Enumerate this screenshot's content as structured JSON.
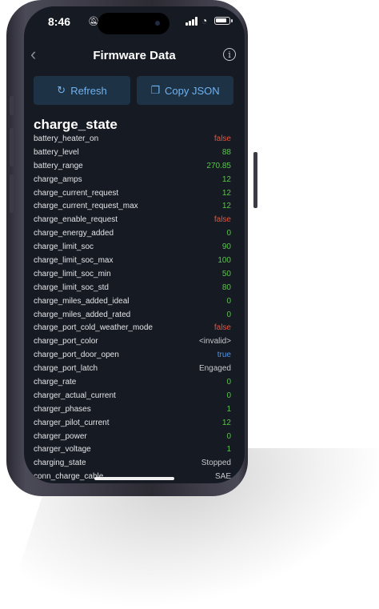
{
  "status_bar": {
    "time": "8:46"
  },
  "nav": {
    "title": "Firmware Data",
    "back_icon": "chevron-left-icon",
    "info_icon": "info-icon"
  },
  "actions": {
    "refresh_label": "Refresh",
    "copy_label": "Copy JSON"
  },
  "section_title": "charge_state",
  "colors": {
    "false": "#e8533f",
    "true": "#4f95e6",
    "number": "#5cc24e",
    "text": "#c6c9cd",
    "button_bg": "#1e3245",
    "button_text": "#6fb2ef"
  },
  "rows": [
    {
      "key": "battery_heater_on",
      "value": "false",
      "type": "bool-false"
    },
    {
      "key": "battery_level",
      "value": "88",
      "type": "num"
    },
    {
      "key": "battery_range",
      "value": "270.85",
      "type": "num"
    },
    {
      "key": "charge_amps",
      "value": "12",
      "type": "num"
    },
    {
      "key": "charge_current_request",
      "value": "12",
      "type": "num"
    },
    {
      "key": "charge_current_request_max",
      "value": "12",
      "type": "num"
    },
    {
      "key": "charge_enable_request",
      "value": "false",
      "type": "bool-false"
    },
    {
      "key": "charge_energy_added",
      "value": "0",
      "type": "num"
    },
    {
      "key": "charge_limit_soc",
      "value": "90",
      "type": "num"
    },
    {
      "key": "charge_limit_soc_max",
      "value": "100",
      "type": "num"
    },
    {
      "key": "charge_limit_soc_min",
      "value": "50",
      "type": "num"
    },
    {
      "key": "charge_limit_soc_std",
      "value": "80",
      "type": "num"
    },
    {
      "key": "charge_miles_added_ideal",
      "value": "0",
      "type": "num"
    },
    {
      "key": "charge_miles_added_rated",
      "value": "0",
      "type": "num"
    },
    {
      "key": "charge_port_cold_weather_mode",
      "value": "false",
      "type": "bool-false"
    },
    {
      "key": "charge_port_color",
      "value": "<invalid>",
      "type": "str"
    },
    {
      "key": "charge_port_door_open",
      "value": "true",
      "type": "bool-true"
    },
    {
      "key": "charge_port_latch",
      "value": "Engaged",
      "type": "str"
    },
    {
      "key": "charge_rate",
      "value": "0",
      "type": "num"
    },
    {
      "key": "charger_actual_current",
      "value": "0",
      "type": "num"
    },
    {
      "key": "charger_phases",
      "value": "1",
      "type": "num"
    },
    {
      "key": "charger_pilot_current",
      "value": "12",
      "type": "num"
    },
    {
      "key": "charger_power",
      "value": "0",
      "type": "num"
    },
    {
      "key": "charger_voltage",
      "value": "1",
      "type": "num"
    },
    {
      "key": "charging_state",
      "value": "Stopped",
      "type": "str"
    },
    {
      "key": "conn_charge_cable",
      "value": "SAE",
      "type": "str"
    }
  ]
}
